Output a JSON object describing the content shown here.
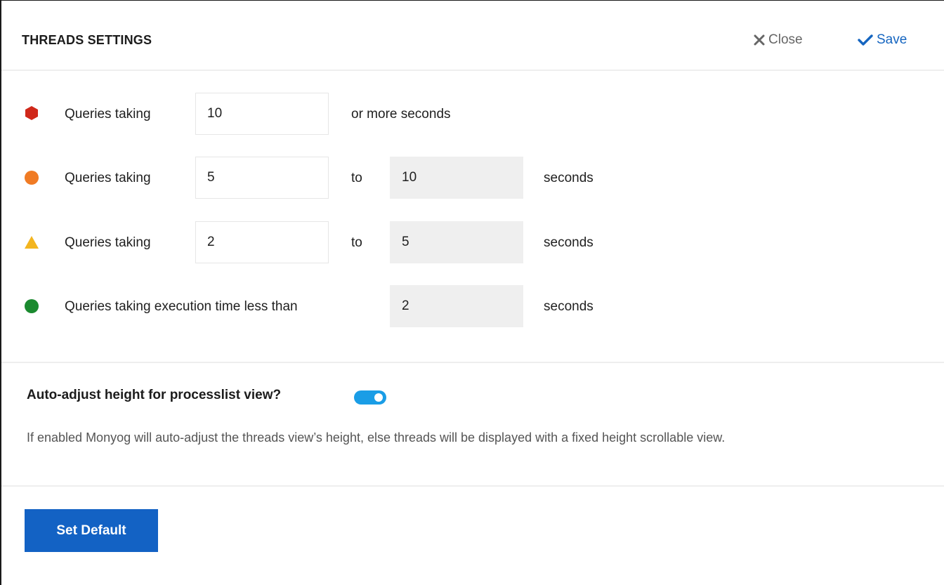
{
  "header": {
    "title": "THREADS SETTINGS",
    "close_label": "Close",
    "save_label": "Save"
  },
  "rows": [
    {
      "icon": "red-hexagon-icon",
      "color": "#d0281a",
      "label": "Queries taking",
      "from_value": "10",
      "suffix": "or more seconds"
    },
    {
      "icon": "orange-circle-icon",
      "color": "#f07b24",
      "label": "Queries taking",
      "from_value": "5",
      "connector": "to",
      "to_value": "10",
      "suffix": "seconds"
    },
    {
      "icon": "yellow-triangle-icon",
      "color": "#f3b51f",
      "label": "Queries taking",
      "from_value": "2",
      "connector": "to",
      "to_value": "5",
      "suffix": "seconds"
    },
    {
      "icon": "green-circle-icon",
      "color": "#1b8a2f",
      "label": "Queries taking execution time less than",
      "to_value": "2",
      "suffix": "seconds"
    }
  ],
  "auto_adjust": {
    "title": "Auto-adjust height for processlist view?",
    "enabled": true,
    "toggle_color": "#1a9de6",
    "description": "If enabled Monyog will auto-adjust the threads view’s height, else threads will be displayed with a fixed height scrollable view."
  },
  "footer": {
    "set_default_label": "Set Default",
    "button_color": "#1362c4"
  }
}
